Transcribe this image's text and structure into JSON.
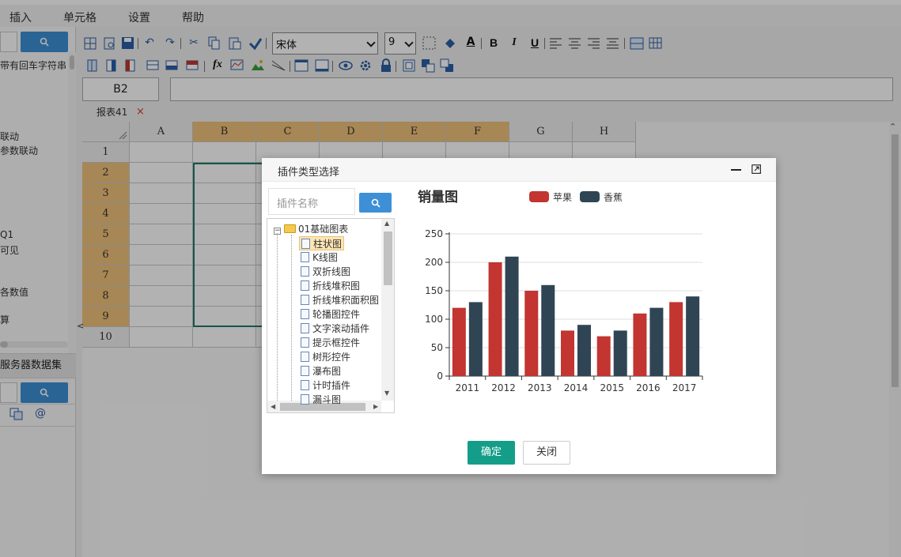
{
  "menu": [
    "插入",
    "单元格",
    "设置",
    "帮助"
  ],
  "left_panel": {
    "lines": [
      "带有回车字符串",
      "联动",
      "参数联动",
      "Q1",
      "可见",
      "各数值",
      "算"
    ],
    "section_title": "服务器数据集"
  },
  "toolbar": {
    "font_name": "宋体",
    "font_size": "9",
    "bold": "B",
    "italic": "I",
    "underline": "U",
    "fx": "fx"
  },
  "formula": {
    "cell_ref": "B2",
    "value": ""
  },
  "sheet_tab": {
    "label": "报表41",
    "close": "×"
  },
  "grid": {
    "columns": [
      "A",
      "B",
      "C",
      "D",
      "E",
      "F",
      "G",
      "H"
    ],
    "selected_columns": [
      "B",
      "C",
      "D",
      "E",
      "F"
    ],
    "rows": [
      "1",
      "2",
      "3",
      "4",
      "5",
      "6",
      "7",
      "8",
      "9",
      "10"
    ],
    "selected_rows": [
      "2",
      "3",
      "4",
      "5",
      "6",
      "7",
      "8",
      "9"
    ]
  },
  "dialog": {
    "title": "插件类型选择",
    "search_placeholder": "插件名称",
    "tree": {
      "folder": "01基础图表",
      "items": [
        "柱状图",
        "K线图",
        "双折线图",
        "折线堆积图",
        "折线堆积面积图",
        "轮播图控件",
        "文字滚动插件",
        "提示框控件",
        "树形控件",
        "瀑布图",
        "计时插件",
        "漏斗图"
      ],
      "selected": "柱状图"
    },
    "ok_label": "确定",
    "close_label": "关闭"
  },
  "chart_data": {
    "type": "bar",
    "title": "销量图",
    "categories": [
      "2011",
      "2012",
      "2013",
      "2014",
      "2015",
      "2016",
      "2017"
    ],
    "series": [
      {
        "name": "苹果",
        "color": "#c23531",
        "values": [
          120,
          200,
          150,
          80,
          70,
          110,
          130
        ]
      },
      {
        "name": "香蕉",
        "color": "#2f4554",
        "values": [
          130,
          210,
          160,
          90,
          80,
          120,
          140
        ]
      }
    ],
    "yticks": [
      "0",
      "50",
      "100",
      "150",
      "200",
      "250"
    ],
    "ylim": [
      0,
      250
    ],
    "grid": true,
    "legend": "top"
  }
}
